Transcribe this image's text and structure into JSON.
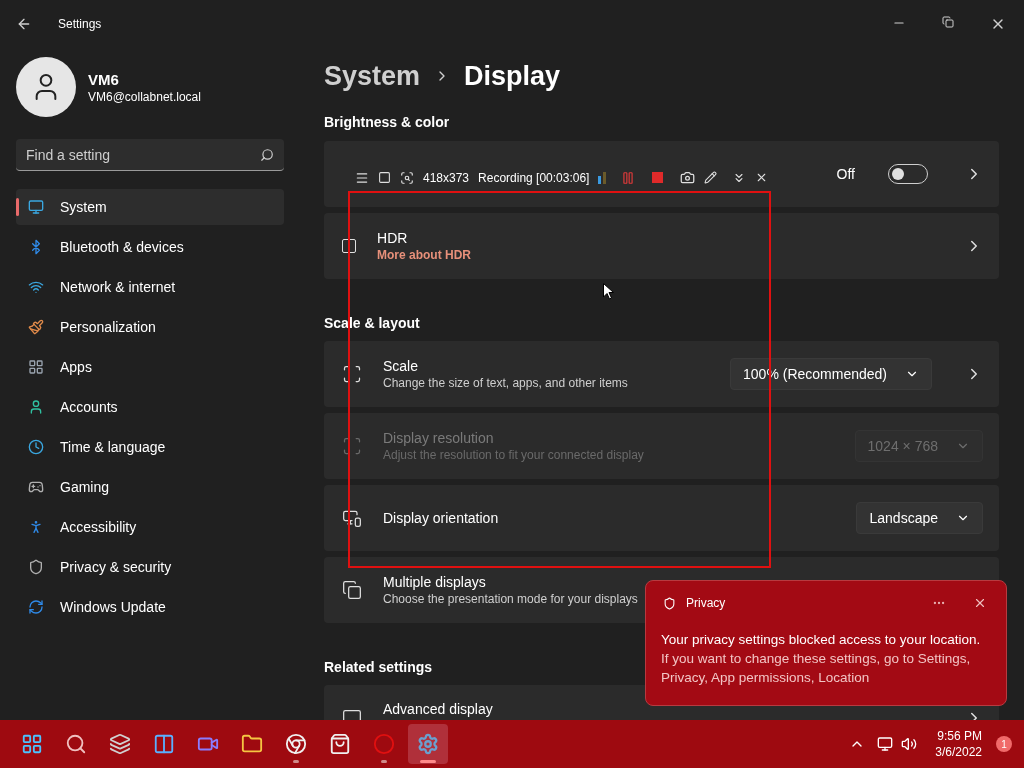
{
  "window": {
    "title": "Settings"
  },
  "account": {
    "name": "VM6",
    "email": "VM6@collabnet.local"
  },
  "search": {
    "placeholder": "Find a setting"
  },
  "sidebar": {
    "items": [
      {
        "label": "System",
        "selected": true
      },
      {
        "label": "Bluetooth & devices",
        "selected": false
      },
      {
        "label": "Network & internet",
        "selected": false
      },
      {
        "label": "Personalization",
        "selected": false
      },
      {
        "label": "Apps",
        "selected": false
      },
      {
        "label": "Accounts",
        "selected": false
      },
      {
        "label": "Time & language",
        "selected": false
      },
      {
        "label": "Gaming",
        "selected": false
      },
      {
        "label": "Accessibility",
        "selected": false
      },
      {
        "label": "Privacy & security",
        "selected": false
      },
      {
        "label": "Windows Update",
        "selected": false
      }
    ]
  },
  "breadcrumb": {
    "parent": "System",
    "current": "Display"
  },
  "sections": [
    {
      "title": "Brightness & color",
      "cards": [
        {
          "kind": "toggle",
          "state_label": "Off",
          "on": false
        },
        {
          "kind": "link",
          "title": "HDR",
          "link": "More about HDR"
        }
      ]
    },
    {
      "title": "Scale & layout",
      "cards": [
        {
          "kind": "dropdown",
          "title": "Scale",
          "subtitle": "Change the size of text, apps, and other items",
          "value": "100% (Recommended)",
          "disabled": false,
          "chevron": true
        },
        {
          "kind": "dropdown",
          "title": "Display resolution",
          "subtitle": "Adjust the resolution to fit your connected display",
          "value": "1024 × 768",
          "disabled": true,
          "chevron": false
        },
        {
          "kind": "dropdown",
          "title": "Display orientation",
          "value": "Landscape",
          "disabled": false,
          "chevron": false
        },
        {
          "kind": "nav",
          "title": "Multiple displays",
          "subtitle": "Choose the presentation mode for your displays"
        }
      ]
    },
    {
      "title": "Related settings",
      "cards": [
        {
          "kind": "nav",
          "title": "Advanced display",
          "chevron": true
        }
      ]
    }
  ],
  "recorder": {
    "size": "418x373",
    "status": "Recording [00:03:06]"
  },
  "toast": {
    "app": "Privacy",
    "heading": "Your privacy settings blocked access to your location.",
    "body": "If you want to change these settings, go to Settings, Privacy, App permissions, Location"
  },
  "taskbar": {
    "apps": [
      {
        "running": false,
        "selected": false
      },
      {
        "running": false,
        "selected": false
      },
      {
        "running": false,
        "selected": false
      },
      {
        "running": false,
        "selected": false
      },
      {
        "running": false,
        "selected": false
      },
      {
        "running": false,
        "selected": false
      },
      {
        "running": true,
        "selected": false
      },
      {
        "running": false,
        "selected": false
      },
      {
        "running": true,
        "selected": false
      },
      {
        "running": true,
        "selected": true
      }
    ]
  },
  "tray": {
    "time": "9:56 PM",
    "date": "3/6/2022",
    "notifications": "1"
  }
}
